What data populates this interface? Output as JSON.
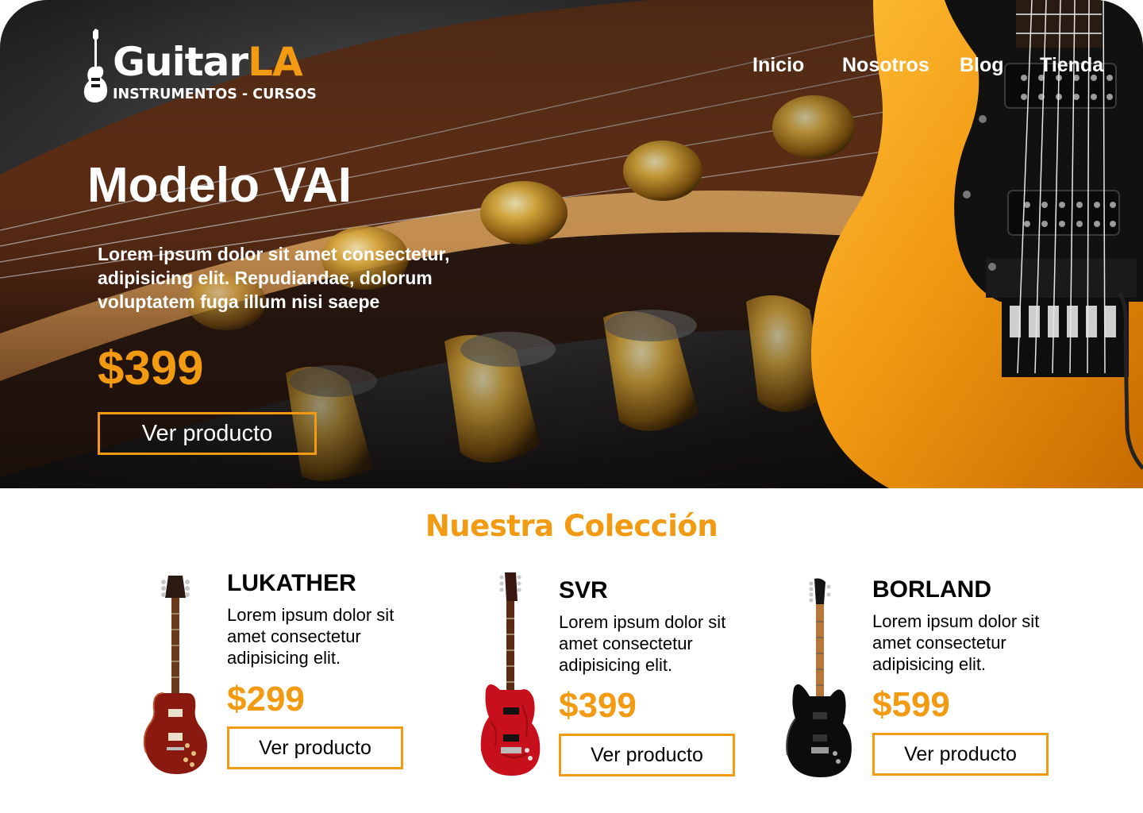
{
  "brand": {
    "name_main": "Guitar",
    "name_accent": "LA",
    "tagline": "INSTRUMENTOS - CURSOS",
    "logo_icon": "guitar-icon"
  },
  "nav": {
    "items": [
      {
        "label": "Inicio"
      },
      {
        "label": "Nosotros"
      },
      {
        "label": "Blog"
      },
      {
        "label": "Tienda"
      }
    ]
  },
  "hero": {
    "title": "Modelo VAI",
    "description": "Lorem ipsum dolor sit amet consectetur, adipisicing elit. Repudiandae, dolorum voluptatem fuga illum nisi saepe",
    "price": "$399",
    "button_label": "Ver producto"
  },
  "collection": {
    "title": "Nuestra Colección",
    "products": [
      {
        "name": "LUKATHER",
        "description": "Lorem ipsum dolor sit amet consectetur adipisicing elit.",
        "price": "$299",
        "button_label": "Ver producto",
        "image_icon": "les-paul-guitar-icon"
      },
      {
        "name": "SVR",
        "description": "Lorem ipsum dolor sit amet consectetur adipisicing elit.",
        "price": "$399",
        "button_label": "Ver producto",
        "image_icon": "red-electric-guitar-icon"
      },
      {
        "name": "BORLAND",
        "description": "Lorem ipsum dolor sit amet consectetur adipisicing elit.",
        "price": "$599",
        "button_label": "Ver producto",
        "image_icon": "black-electric-guitar-icon"
      }
    ]
  },
  "colors": {
    "accent": "#f29a12",
    "text": "#000000",
    "hero_text": "#ffffff",
    "background": "#ffffff"
  }
}
